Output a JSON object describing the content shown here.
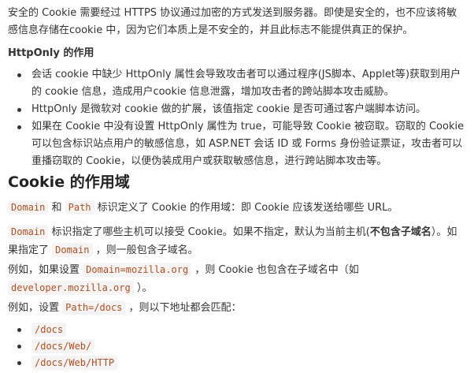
{
  "intro": {
    "text": "安全的 Cookie 需要经过 HTTPS 协议通过加密的方式发送到服务器。即使是安全的，也不应该将敏感信息存储在cookie 中，因为它们本质上是不安全的，并且此标志不能提供真正的保护。"
  },
  "httponly": {
    "heading": "HttpOnly 的作用",
    "items": [
      "会话 cookie 中缺少 HttpOnly 属性会导致攻击者可以通过程序(JS脚本、Applet等)获取到用户的 cookie 信息，造成用户cookie 信息泄露，增加攻击者的跨站脚本攻击威胁。",
      "HttpOnly 是微软对 cookie 做的扩展，该值指定 cookie 是否可通过客户端脚本访问。",
      "如果在 Cookie 中没有设置 HttpOnly 属性为 true，可能导致 Cookie 被窃取。窃取的 Cookie 可以包含标识站点用户的敏感信息，如 ASP.NET 会话 ID 或 Forms 身份验证票证，攻击者可以重播窃取的 Cookie，以便伪装成用户或获取敏感信息，进行跨站脚本攻击等。"
    ]
  },
  "scope": {
    "heading": "Cookie 的作用域",
    "p1": {
      "code_domain": "Domain",
      "and": " 和 ",
      "code_path": "Path",
      "rest": " 标识定义了 Cookie 的作用域：即 Cookie 应该发送给哪些 URL。"
    },
    "p2": {
      "code_domain": "Domain",
      "text1": " 标识指定了哪些主机可以接受 Cookie。如果不指定，默认为当前主机(",
      "bold": "不包含子域名",
      "text2": "）。如果指定了 ",
      "code_domain2": "Domain",
      "text3": " ，则一般包含子域名。"
    },
    "p3": {
      "text1": "例如，如果设置 ",
      "code1": "Domain=mozilla.org",
      "text2": " ，则 Cookie 也包含在子域名中（如 ",
      "code2": "developer.mozilla.org",
      "text3": " ）。"
    },
    "p4": {
      "text1": "例如，设置 ",
      "code1": "Path=/docs",
      "text2": " ，则以下地址都会匹配："
    },
    "paths": [
      "/docs",
      "/docs/Web/",
      "/docs/Web/HTTP"
    ]
  }
}
